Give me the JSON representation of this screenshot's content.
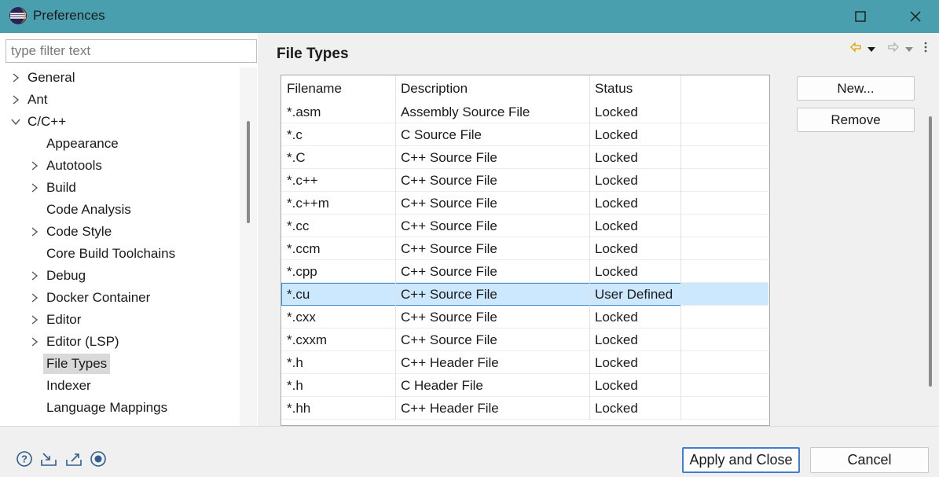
{
  "window": {
    "title": "Preferences",
    "accent_color": "#4a9fae",
    "icons": {
      "app": "eclipse-icon",
      "minimize": "minimize-icon",
      "maximize": "maximize-icon",
      "close": "close-icon"
    }
  },
  "filter": {
    "placeholder": "type filter text",
    "value": ""
  },
  "tree": {
    "items": [
      {
        "label": "General",
        "level": 0,
        "expander": "collapsed"
      },
      {
        "label": "Ant",
        "level": 0,
        "expander": "collapsed"
      },
      {
        "label": "C/C++",
        "level": 0,
        "expander": "expanded"
      },
      {
        "label": "Appearance",
        "level": 1,
        "expander": "none"
      },
      {
        "label": "Autotools",
        "level": 1,
        "expander": "collapsed"
      },
      {
        "label": "Build",
        "level": 1,
        "expander": "collapsed"
      },
      {
        "label": "Code Analysis",
        "level": 1,
        "expander": "none"
      },
      {
        "label": "Code Style",
        "level": 1,
        "expander": "collapsed"
      },
      {
        "label": "Core Build Toolchains",
        "level": 1,
        "expander": "none"
      },
      {
        "label": "Debug",
        "level": 1,
        "expander": "collapsed"
      },
      {
        "label": "Docker Container",
        "level": 1,
        "expander": "collapsed"
      },
      {
        "label": "Editor",
        "level": 1,
        "expander": "collapsed"
      },
      {
        "label": "Editor (LSP)",
        "level": 1,
        "expander": "collapsed"
      },
      {
        "label": "File Types",
        "level": 1,
        "expander": "none",
        "selected": true
      },
      {
        "label": "Indexer",
        "level": 1,
        "expander": "none"
      },
      {
        "label": "Language Mappings",
        "level": 1,
        "expander": "none"
      }
    ]
  },
  "page": {
    "title": "File Types",
    "nav_icons": [
      "back-arrow-icon",
      "back-menu-icon",
      "forward-arrow-icon",
      "forward-menu-icon",
      "view-menu-icon"
    ]
  },
  "table": {
    "columns": [
      "Filename",
      "Description",
      "Status"
    ],
    "rows": [
      {
        "filename": "*.asm",
        "description": "Assembly Source File",
        "status": "Locked"
      },
      {
        "filename": "*.c",
        "description": "C Source File",
        "status": "Locked"
      },
      {
        "filename": "*.C",
        "description": "C++ Source File",
        "status": "Locked"
      },
      {
        "filename": "*.c++",
        "description": "C++ Source File",
        "status": "Locked"
      },
      {
        "filename": "*.c++m",
        "description": "C++ Source File",
        "status": "Locked"
      },
      {
        "filename": "*.cc",
        "description": "C++ Source File",
        "status": "Locked"
      },
      {
        "filename": "*.ccm",
        "description": "C++ Source File",
        "status": "Locked"
      },
      {
        "filename": "*.cpp",
        "description": "C++ Source File",
        "status": "Locked"
      },
      {
        "filename": "*.cu",
        "description": "C++ Source File",
        "status": "User Defined",
        "selected": true
      },
      {
        "filename": "*.cxx",
        "description": "C++ Source File",
        "status": "Locked"
      },
      {
        "filename": "*.cxxm",
        "description": "C++ Source File",
        "status": "Locked"
      },
      {
        "filename": "*.h",
        "description": "C++ Header File",
        "status": "Locked"
      },
      {
        "filename": "*.h",
        "description": "C Header File",
        "status": "Locked"
      },
      {
        "filename": "*.hh",
        "description": "C++ Header File",
        "status": "Locked"
      }
    ],
    "selection_color": "#cce8ff"
  },
  "side_buttons": {
    "new_label": "New...",
    "remove_label": "Remove"
  },
  "footer": {
    "icons": [
      "help-icon",
      "import-icon",
      "export-icon",
      "record-icon"
    ],
    "apply_close_label": "Apply and Close",
    "cancel_label": "Cancel"
  }
}
